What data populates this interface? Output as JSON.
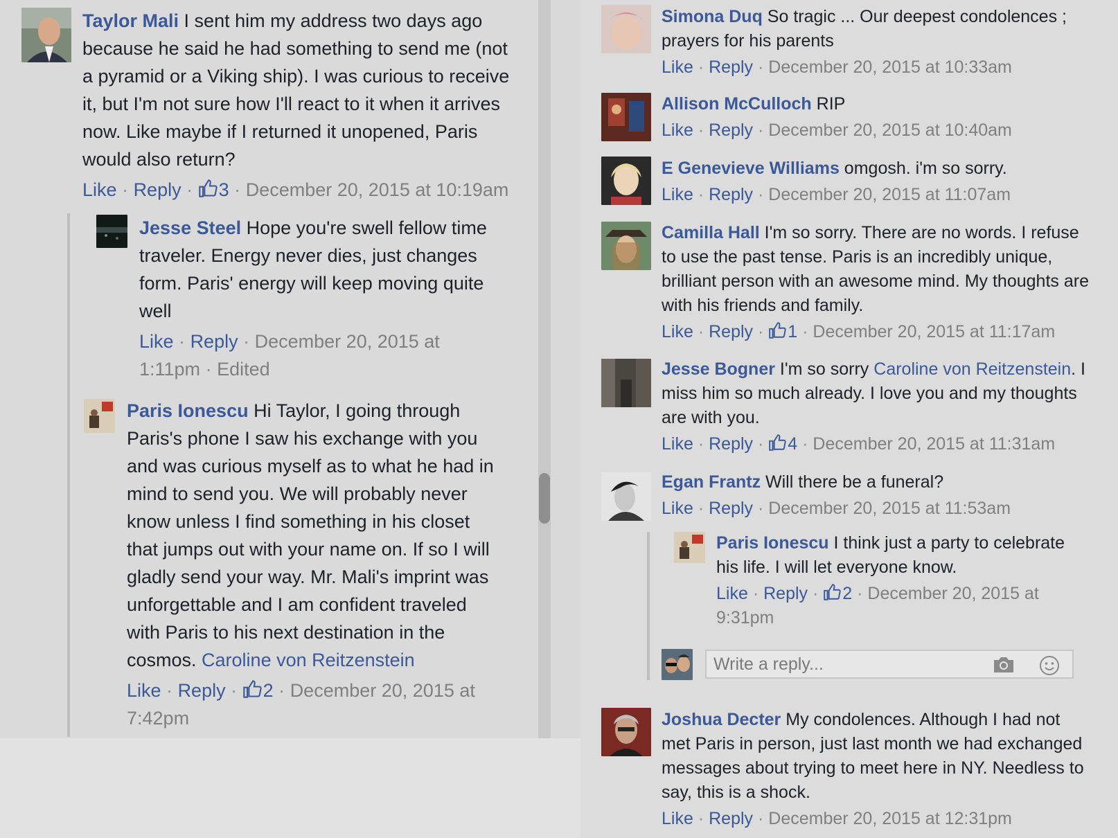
{
  "actions": {
    "like": "Like",
    "reply": "Reply",
    "dot": "·"
  },
  "comments": {
    "c1": {
      "author": "Taylor Mali",
      "text": " I sent him my address two days ago because he said he had something to send me (not a pyramid or a Viking ship). I was curious to receive it, but I'm not sure how I'll react to it when it arrives now. Like maybe if I returned it unopened, Paris would also return?",
      "likes": "3",
      "time": "December 20, 2015 at 10:19am"
    },
    "c1r1": {
      "author": "Jesse Steel",
      "text": " Hope you're swell fellow time traveler. Energy never dies, just changes form. Paris' energy will keep moving quite well",
      "time": "December 20, 2015 at 1:11pm",
      "edited": "Edited"
    },
    "c1r2": {
      "author": "Paris Ionescu",
      "text": " Hi Taylor, I going through Paris's phone I saw his exchange with you and was curious myself as to what he had in mind to send you. We will probably never know unless I find something in his closet that jumps out with your name on. If so I will gladly send your way. Mr. Mali's imprint was unforgettable and I am confident traveled with Paris to his next destination in the cosmos. ",
      "mention": "Caroline von Reitzenstein",
      "likes": "2",
      "time": "December 20, 2015 at 7:42pm"
    },
    "r1": {
      "author": "Simona Duq",
      "text": " So tragic ... Our deepest condolences ; prayers for his parents",
      "time": "December 20, 2015 at 10:33am"
    },
    "r2": {
      "author": "Allison McCulloch",
      "text": " RIP",
      "time": "December 20, 2015 at 10:40am"
    },
    "r3": {
      "author": "E Genevieve Williams",
      "text": " omgosh. i'm so sorry.",
      "time": "December 20, 2015 at 11:07am"
    },
    "r4": {
      "author": "Camilla Hall",
      "text": " I'm so sorry. There are no words. I refuse to use the past tense. Paris is an incredibly unique, brilliant person with an awesome mind. My thoughts are with his friends and family.",
      "likes": "1",
      "time": "December 20, 2015 at 11:17am"
    },
    "r5": {
      "author": "Jesse Bogner",
      "text": " I'm so sorry ",
      "mention": "Caroline von Reitzenstein",
      "text_after": ". I miss him so much already. I love you and my thoughts are with you.",
      "likes": "4",
      "time": "December 20, 2015 at 11:31am"
    },
    "r6": {
      "author": "Egan Frantz",
      "text": " Will there be a funeral?",
      "time": "December 20, 2015 at 11:53am"
    },
    "r6r1": {
      "author": "Paris Ionescu",
      "text": " I think just a party to celebrate his life. I will let everyone know.",
      "likes": "2",
      "time": "December 20, 2015 at 9:31pm"
    },
    "r7": {
      "author": "Joshua Decter",
      "text": " My condolences. Although I had not met Paris in person, just last month we had exchanged messages about trying to meet here in NY. Needless to say, this is a shock.",
      "time": "December 20, 2015 at 12:31pm"
    }
  },
  "reply_box": {
    "placeholder": "Write a reply..."
  },
  "icons": {
    "like": "thumbs-up-icon",
    "camera": "camera-icon",
    "emoji": "smiley-icon"
  },
  "colors": {
    "link": "#3b5998",
    "meta": "#7f7f7f",
    "background": "#dadada"
  }
}
